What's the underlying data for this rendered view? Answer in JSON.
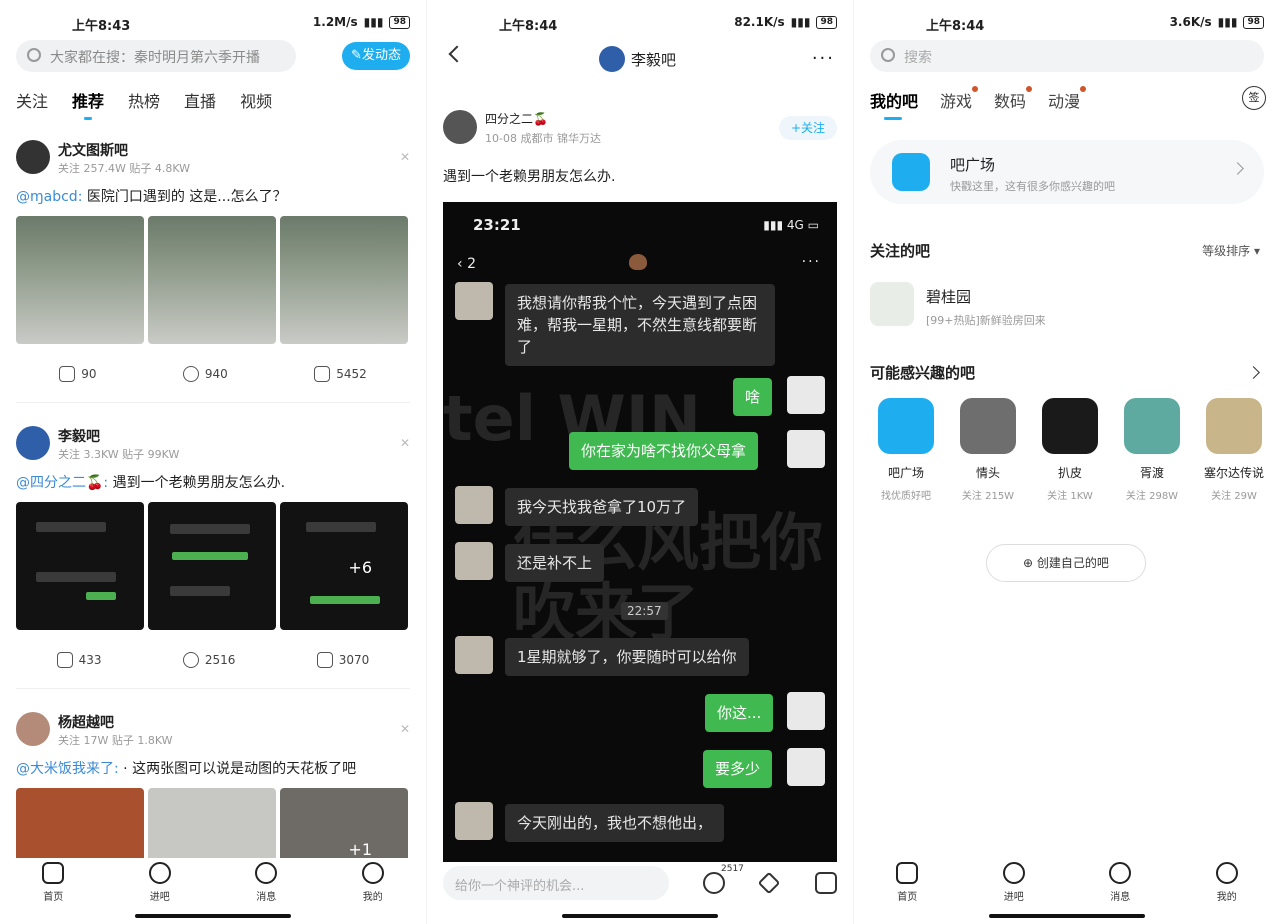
{
  "status": [
    {
      "time": "上午8:43",
      "speed": "1.2M/s",
      "battery": "98"
    },
    {
      "time": "上午8:44",
      "speed": "82.1K/s",
      "battery": "98"
    },
    {
      "time": "上午8:44",
      "speed": "3.6K/s",
      "battery": "98"
    }
  ],
  "home": {
    "search_placeholder": "大家都在搜：秦时明月第六季开播",
    "post_button": "发动态",
    "tabs": [
      "关注",
      "推荐",
      "热榜",
      "直播",
      "视频"
    ],
    "feed": [
      {
        "forum": "尤文图斯吧",
        "meta": "关注 257.4W  贴子 4.8KW",
        "mention": "@ɱabcd:",
        "text": " 医院门口遇到的 这是...怎么了？",
        "repost": "90",
        "comment": "940",
        "like": "5452"
      },
      {
        "forum": "李毅吧",
        "meta": "关注 3.3KW  贴子 99KW",
        "mention": "@四分之二🍒:",
        "text": " 遇到一个老赖男朋友怎么办.",
        "more": "+6",
        "repost": "433",
        "comment": "2516",
        "like": "3070"
      },
      {
        "forum": "杨超越吧",
        "meta": "关注 17W  贴子 1.8KW",
        "mention": "@大米饭我来了:",
        "text": " · 这两张图可以说是动图的天花板了吧",
        "more": "+1"
      }
    ]
  },
  "nav": [
    "首页",
    "进吧",
    "消息",
    "我的"
  ],
  "post": {
    "forum": "李毅吧",
    "author": "四分之二🍒",
    "date": "10-08  成都市 锦华万达",
    "follow": "+关注",
    "title": "遇到一个老赖男朋友怎么办.",
    "shot_time": "23:21",
    "shot_net": "4G",
    "shot_back": "2",
    "watermark1": "tel WIN",
    "watermark2": "什么风把你",
    "watermark3": "吹来了",
    "timestamp": "22:57",
    "messages": [
      {
        "dir": "in",
        "text": "我想请你帮我个忙，今天遇到了点困难，帮我一星期，不然生意线都要断了"
      },
      {
        "dir": "out",
        "text": "啥"
      },
      {
        "dir": "out",
        "text": "你在家为啥不找你父母拿"
      },
      {
        "dir": "in",
        "text": "我今天找我爸拿了10万了"
      },
      {
        "dir": "in",
        "text": "还是补不上"
      },
      {
        "dir": "in",
        "text": "1星期就够了，你要随时可以给你"
      },
      {
        "dir": "out",
        "text": "你这..."
      },
      {
        "dir": "out",
        "text": "要多少"
      },
      {
        "dir": "in",
        "text": "今天刚出的，我也不想他出，"
      }
    ],
    "comment_placeholder": "给你一个神评的机会...",
    "comment_count": "2517"
  },
  "forums": {
    "search_placeholder": "搜索",
    "tabs": [
      "我的吧",
      "游戏",
      "数码",
      "动漫"
    ],
    "sign": "签",
    "plaza_title": "吧广场",
    "plaza_sub": "快戳这里，这有很多你感兴趣的吧",
    "followed_title": "关注的吧",
    "sort_label": "等级排序 ▾",
    "followed": {
      "name": "碧桂园",
      "sub": "[99+热贴]新鲜验房回来"
    },
    "interest_title": "可能感兴趣的吧",
    "recommend": [
      {
        "name": "吧广场",
        "sub": "找优质好吧",
        "color": "#1eaeef"
      },
      {
        "name": "情头",
        "sub": "关注 215W",
        "color": "#6e6e6e"
      },
      {
        "name": "扒皮",
        "sub": "关注 1KW",
        "color": "#1a1a1a"
      },
      {
        "name": "胥渡",
        "sub": "关注 298W",
        "color": "#5ea9a0"
      },
      {
        "name": "塞尔达传说",
        "sub": "关注 29W",
        "color": "#c9b58a"
      }
    ],
    "create": "创建自己的吧"
  }
}
